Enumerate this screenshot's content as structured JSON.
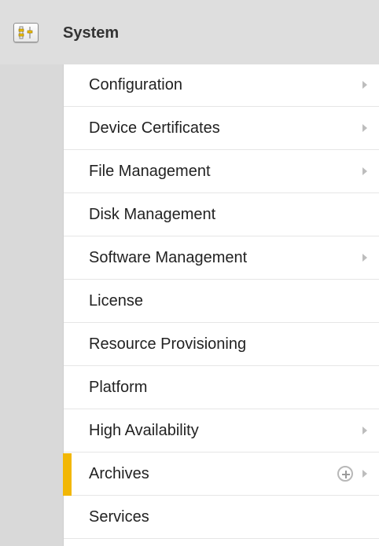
{
  "header": {
    "title": "System",
    "icon": "system-sliders-icon"
  },
  "menu": {
    "items": [
      {
        "label": "Configuration",
        "has_submenu": true
      },
      {
        "label": "Device Certificates",
        "has_submenu": true
      },
      {
        "label": "File Management",
        "has_submenu": true
      },
      {
        "label": "Disk Management",
        "has_submenu": false
      },
      {
        "label": "Software Management",
        "has_submenu": true
      },
      {
        "label": "License",
        "has_submenu": false
      },
      {
        "label": "Resource Provisioning",
        "has_submenu": false
      },
      {
        "label": "Platform",
        "has_submenu": false
      },
      {
        "label": "High Availability",
        "has_submenu": true
      },
      {
        "label": "Archives",
        "has_submenu": true,
        "active": true,
        "add_icon": "plus-circle-icon"
      },
      {
        "label": "Services",
        "has_submenu": false
      }
    ]
  },
  "colors": {
    "active_accent": "#f2b705",
    "menu_background": "#ffffff",
    "panel_background": "#dedede"
  }
}
